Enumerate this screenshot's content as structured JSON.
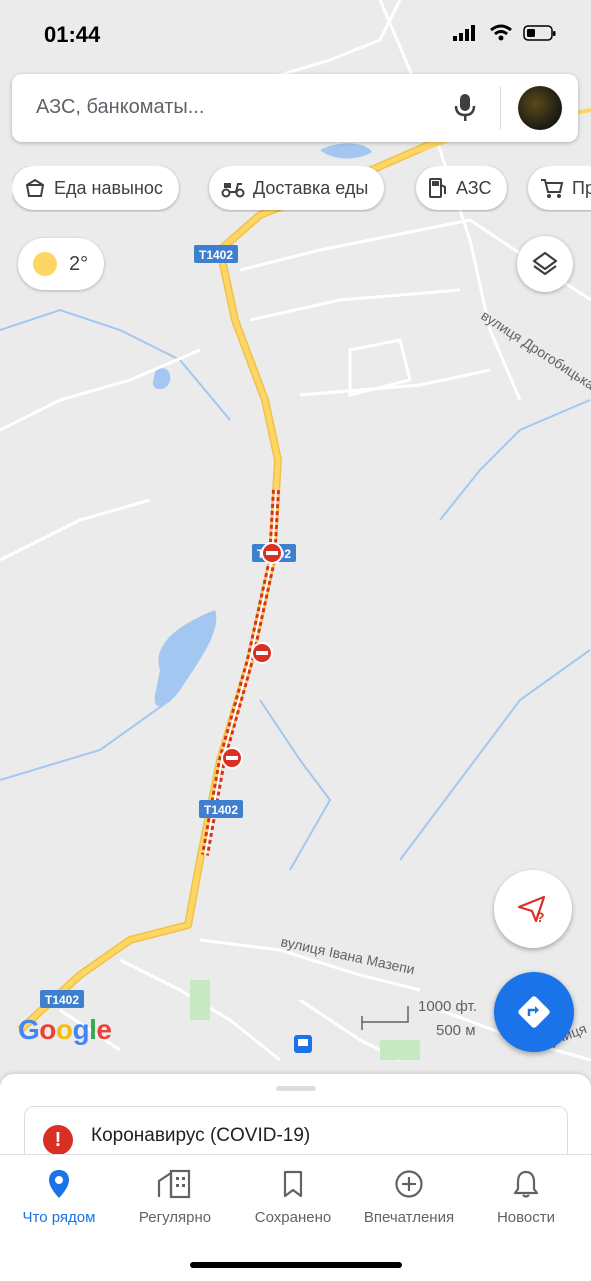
{
  "status_bar": {
    "time": "01:44"
  },
  "search": {
    "placeholder": "АЗС, банкоматы..."
  },
  "chips": [
    {
      "label": "Еда навынос",
      "icon": "takeout-icon"
    },
    {
      "label": "Доставка еды",
      "icon": "delivery-scooter-icon"
    },
    {
      "label": "АЗС",
      "icon": "gas-station-icon"
    },
    {
      "label": "Пр",
      "icon": "shopping-cart-icon"
    }
  ],
  "weather": {
    "temperature": "2°"
  },
  "map": {
    "road_labels": {
      "t1402_a": "T1402",
      "t1402_b": "T1402",
      "t1402_c": "T1402",
      "t1402_d": "T1402"
    },
    "street_labels": {
      "drohobytska": "вулиця Дрогобицька",
      "mazepy": "вулиця Івана Мазепи",
      "bottom_right": "вулиця"
    },
    "scale": {
      "imperial": "1000 фт.",
      "metric": "500 м"
    },
    "logo": "Google",
    "colors": {
      "road": "#fdd663",
      "closure": "#d93025",
      "water": "#a3c7f0",
      "park": "#c6e8c3"
    }
  },
  "sheet": {
    "covid_label": "Коронавирус (COVID-19)"
  },
  "tabs": [
    {
      "label": "Что рядом",
      "active": true
    },
    {
      "label": "Регулярно",
      "active": false
    },
    {
      "label": "Сохранено",
      "active": false
    },
    {
      "label": "Впечатления",
      "active": false
    },
    {
      "label": "Новости",
      "active": false
    }
  ]
}
